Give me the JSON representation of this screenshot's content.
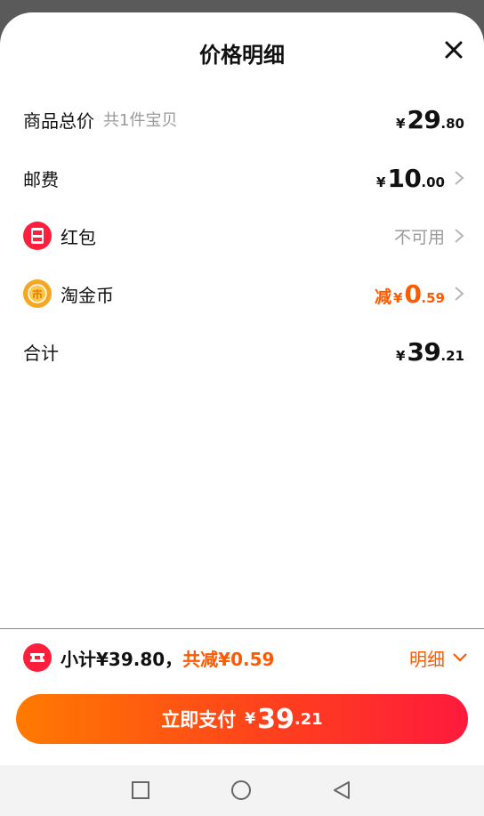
{
  "sheet": {
    "title": "价格明细"
  },
  "rows": {
    "goods": {
      "label": "商品总价",
      "sub": "共1件宝贝",
      "yen": "¥",
      "int": "29",
      "dec": ".80"
    },
    "shipping": {
      "label": "邮费",
      "yen": "¥",
      "int": "10",
      "dec": ".00"
    },
    "redpacket": {
      "label": "红包",
      "value": "不可用"
    },
    "coins": {
      "label": "淘金币",
      "prefix": "减",
      "yen": "¥",
      "int": "0",
      "dec": ".59"
    },
    "total": {
      "label": "合计",
      "yen": "¥",
      "int": "39",
      "dec": ".21"
    }
  },
  "footer": {
    "subtotal": "小计¥39.80，",
    "saving": "共减¥0.59",
    "detail": "明细",
    "pay_label": "立即支付",
    "pay_yen": "¥",
    "pay_int": "39",
    "pay_dec": ".21"
  },
  "colors": {
    "accent": "#ff5a00",
    "red": "#ff1e3c",
    "gold": "#f5a623"
  },
  "icons": {
    "close": "close-icon",
    "redpacket": "red-packet-icon",
    "coin": "gold-coin-icon",
    "chevron": "chevron-right-icon",
    "ticket": "ticket-icon",
    "down": "chevron-down-icon"
  }
}
